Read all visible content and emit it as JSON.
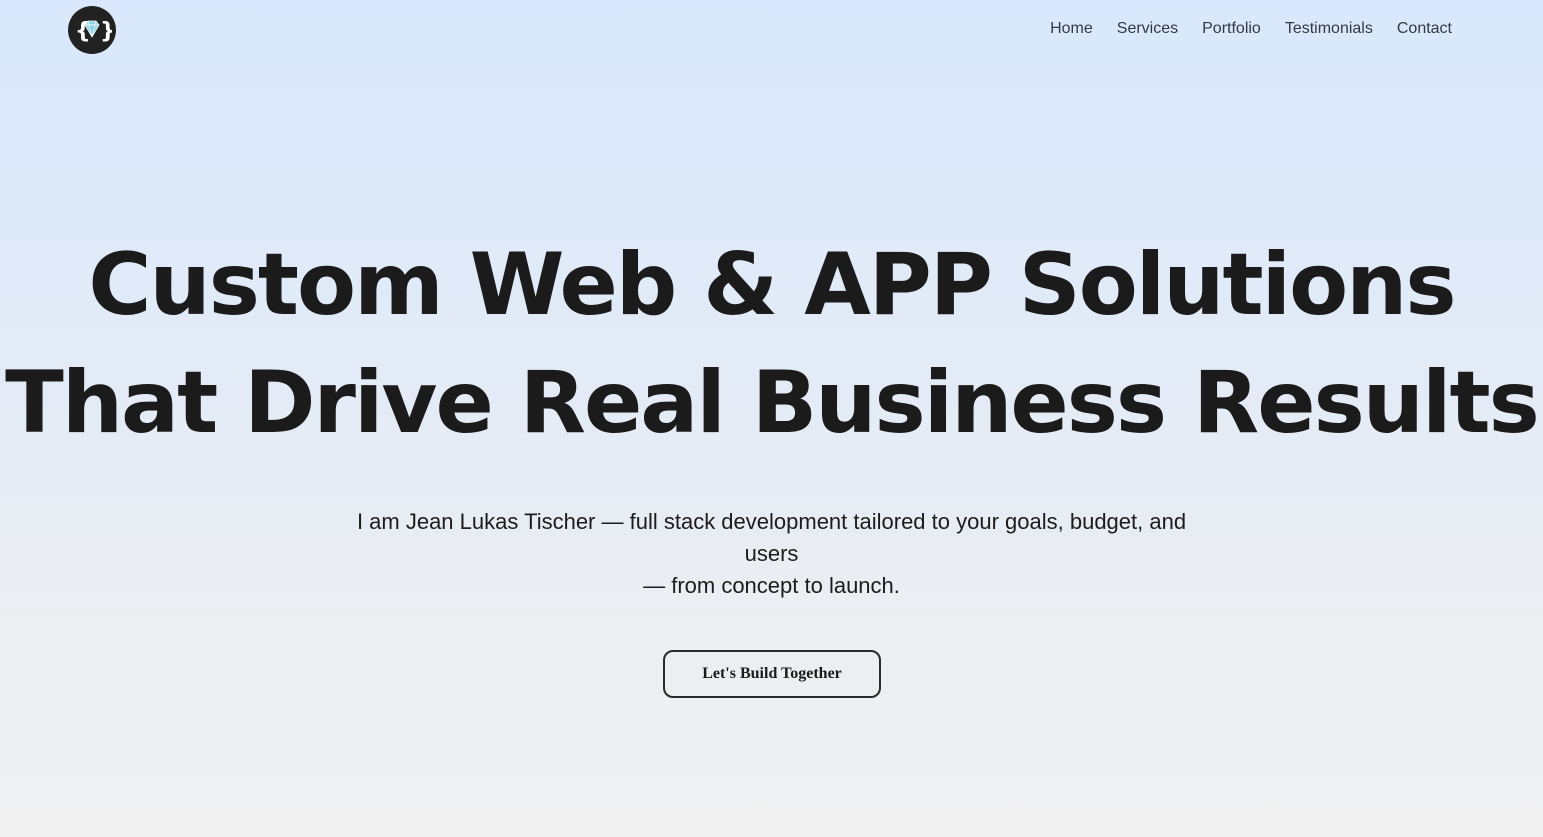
{
  "header": {
    "logo_icon": "diamond-braces-logo",
    "nav": [
      {
        "label": "Home"
      },
      {
        "label": "Services"
      },
      {
        "label": "Portfolio"
      },
      {
        "label": "Testimonials"
      },
      {
        "label": "Contact"
      }
    ]
  },
  "hero": {
    "title_line1": "Custom Web & APP Solutions",
    "title_line2": "That Drive Real Business Results",
    "subtitle_line1": "I am Jean Lukas Tischer — full stack development tailored to your goals, budget, and users",
    "subtitle_line2": "— from concept to launch.",
    "cta_label": "Let's Build Together"
  },
  "colors": {
    "background_top": "#d9e8fc",
    "background_bottom": "#f0f0f1",
    "text": "#1b1b1b",
    "logo_bg": "#222222",
    "logo_accent": "#8fd3e8"
  }
}
